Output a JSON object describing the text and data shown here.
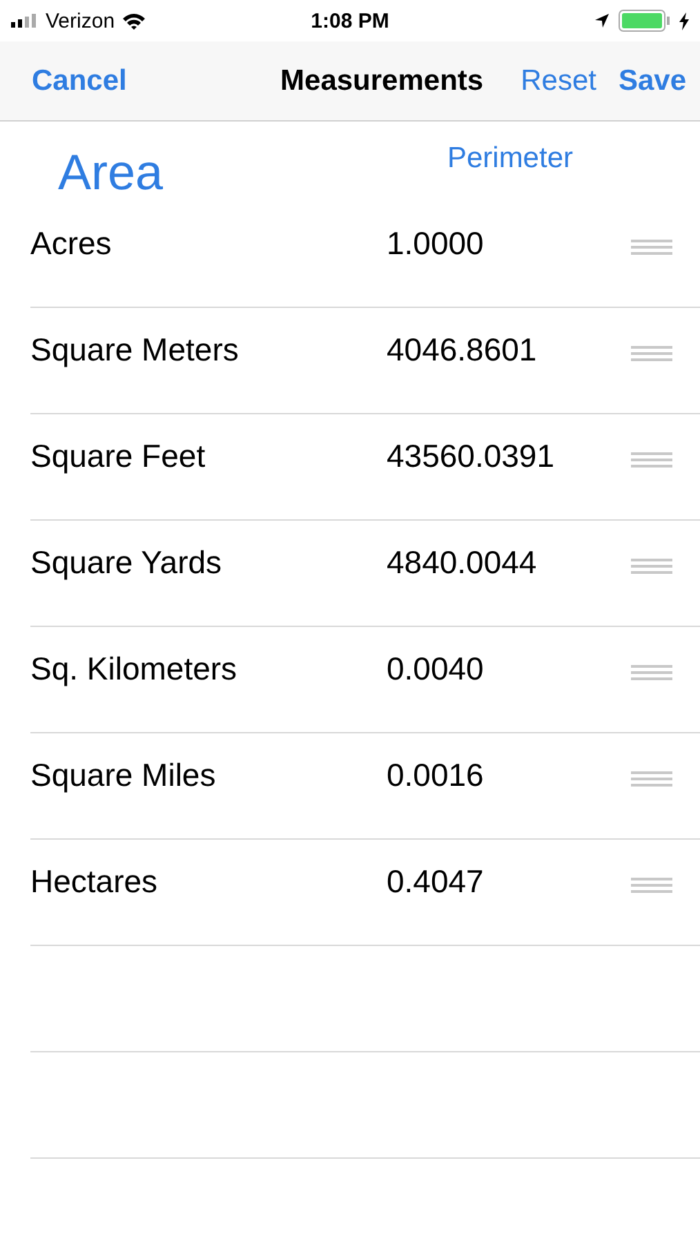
{
  "status_bar": {
    "carrier": "Verizon",
    "time": "1:08 PM",
    "charging": true
  },
  "nav": {
    "cancel": "Cancel",
    "title": "Measurements",
    "reset": "Reset",
    "save": "Save"
  },
  "tabs": [
    {
      "label": "Area",
      "selected": true
    },
    {
      "label": "Perimeter",
      "selected": false
    }
  ],
  "rows": [
    {
      "unit": "Acres",
      "value": "1.0000"
    },
    {
      "unit": "Square Meters",
      "value": "4046.8601"
    },
    {
      "unit": "Square Feet",
      "value": "43560.0391"
    },
    {
      "unit": "Square Yards",
      "value": "4840.0044"
    },
    {
      "unit": "Sq. Kilometers",
      "value": "0.0040"
    },
    {
      "unit": "Square Miles",
      "value": "0.0016"
    },
    {
      "unit": "Hectares",
      "value": "0.4047"
    }
  ]
}
